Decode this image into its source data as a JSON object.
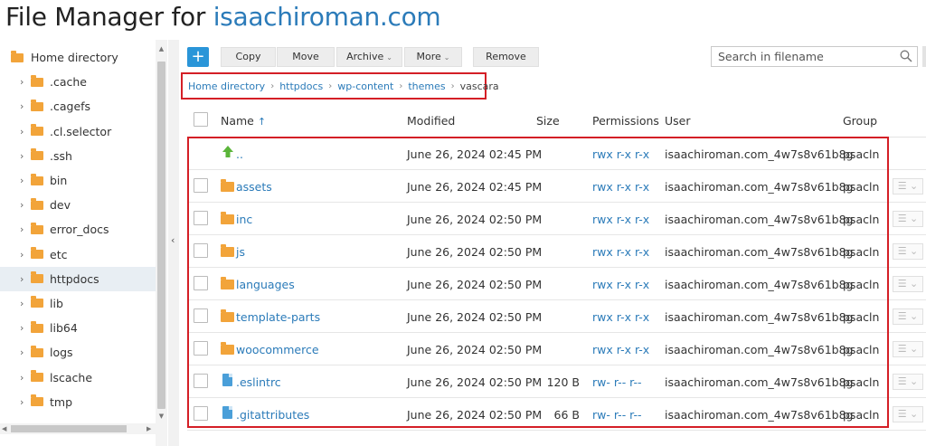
{
  "title": {
    "prefix": "File Manager for ",
    "domain": "isaachiroman.com"
  },
  "sidebar": {
    "root": "Home directory",
    "items": [
      {
        "label": ".cache"
      },
      {
        "label": ".cagefs"
      },
      {
        "label": ".cl.selector"
      },
      {
        "label": ".ssh"
      },
      {
        "label": "bin"
      },
      {
        "label": "dev"
      },
      {
        "label": "error_docs"
      },
      {
        "label": "etc"
      },
      {
        "label": "httpdocs",
        "selected": true
      },
      {
        "label": "lib"
      },
      {
        "label": "lib64"
      },
      {
        "label": "logs"
      },
      {
        "label": "lscache"
      },
      {
        "label": "tmp"
      }
    ]
  },
  "toolbar": {
    "add": "+",
    "copy": "Copy",
    "move": "Move",
    "archive": "Archive",
    "more": "More",
    "remove": "Remove",
    "search_placeholder": "Search in filename"
  },
  "breadcrumb": [
    "Home directory",
    "httpdocs",
    "wp-content",
    "themes",
    "vascara"
  ],
  "columns": {
    "name": "Name",
    "sort_indicator": "↑",
    "modified": "Modified",
    "size": "Size",
    "permissions": "Permissions",
    "user": "User",
    "group": "Group"
  },
  "rows": [
    {
      "type": "up",
      "name": "..",
      "modified": "June 26, 2024 02:45 PM",
      "size": "",
      "permissions": "rwx r-x r-x",
      "user": "isaachiroman.com_4w7s8v61b8g",
      "group": "psacln"
    },
    {
      "type": "folder",
      "name": "assets",
      "modified": "June 26, 2024 02:45 PM",
      "size": "",
      "permissions": "rwx r-x r-x",
      "user": "isaachiroman.com_4w7s8v61b8g",
      "group": "psacln"
    },
    {
      "type": "folder",
      "name": "inc",
      "modified": "June 26, 2024 02:50 PM",
      "size": "",
      "permissions": "rwx r-x r-x",
      "user": "isaachiroman.com_4w7s8v61b8g",
      "group": "psacln"
    },
    {
      "type": "folder",
      "name": "js",
      "modified": "June 26, 2024 02:50 PM",
      "size": "",
      "permissions": "rwx r-x r-x",
      "user": "isaachiroman.com_4w7s8v61b8g",
      "group": "psacln"
    },
    {
      "type": "folder",
      "name": "languages",
      "modified": "June 26, 2024 02:50 PM",
      "size": "",
      "permissions": "rwx r-x r-x",
      "user": "isaachiroman.com_4w7s8v61b8g",
      "group": "psacln"
    },
    {
      "type": "folder",
      "name": "template-parts",
      "modified": "June 26, 2024 02:50 PM",
      "size": "",
      "permissions": "rwx r-x r-x",
      "user": "isaachiroman.com_4w7s8v61b8g",
      "group": "psacln"
    },
    {
      "type": "folder",
      "name": "woocommerce",
      "modified": "June 26, 2024 02:50 PM",
      "size": "",
      "permissions": "rwx r-x r-x",
      "user": "isaachiroman.com_4w7s8v61b8g",
      "group": "psacln"
    },
    {
      "type": "file",
      "name": ".eslintrc",
      "modified": "June 26, 2024 02:50 PM",
      "size": "120 B",
      "permissions": "rw- r-- r--",
      "user": "isaachiroman.com_4w7s8v61b8g",
      "group": "psacln"
    },
    {
      "type": "file",
      "name": ".gitattributes",
      "modified": "June 26, 2024 02:50 PM",
      "size": "66 B",
      "permissions": "rw- r-- r--",
      "user": "isaachiroman.com_4w7s8v61b8g",
      "group": "psacln"
    }
  ],
  "colors": {
    "accent": "#2b7bb9",
    "highlight": "#d41f26",
    "folder": "#f2a43a",
    "add_button": "#2a95d8"
  },
  "icons": {
    "up": "green-up-arrow-icon",
    "folder": "folder-icon",
    "file": "file-icon",
    "search": "search-icon",
    "row_menu": "hamburger-icon"
  }
}
